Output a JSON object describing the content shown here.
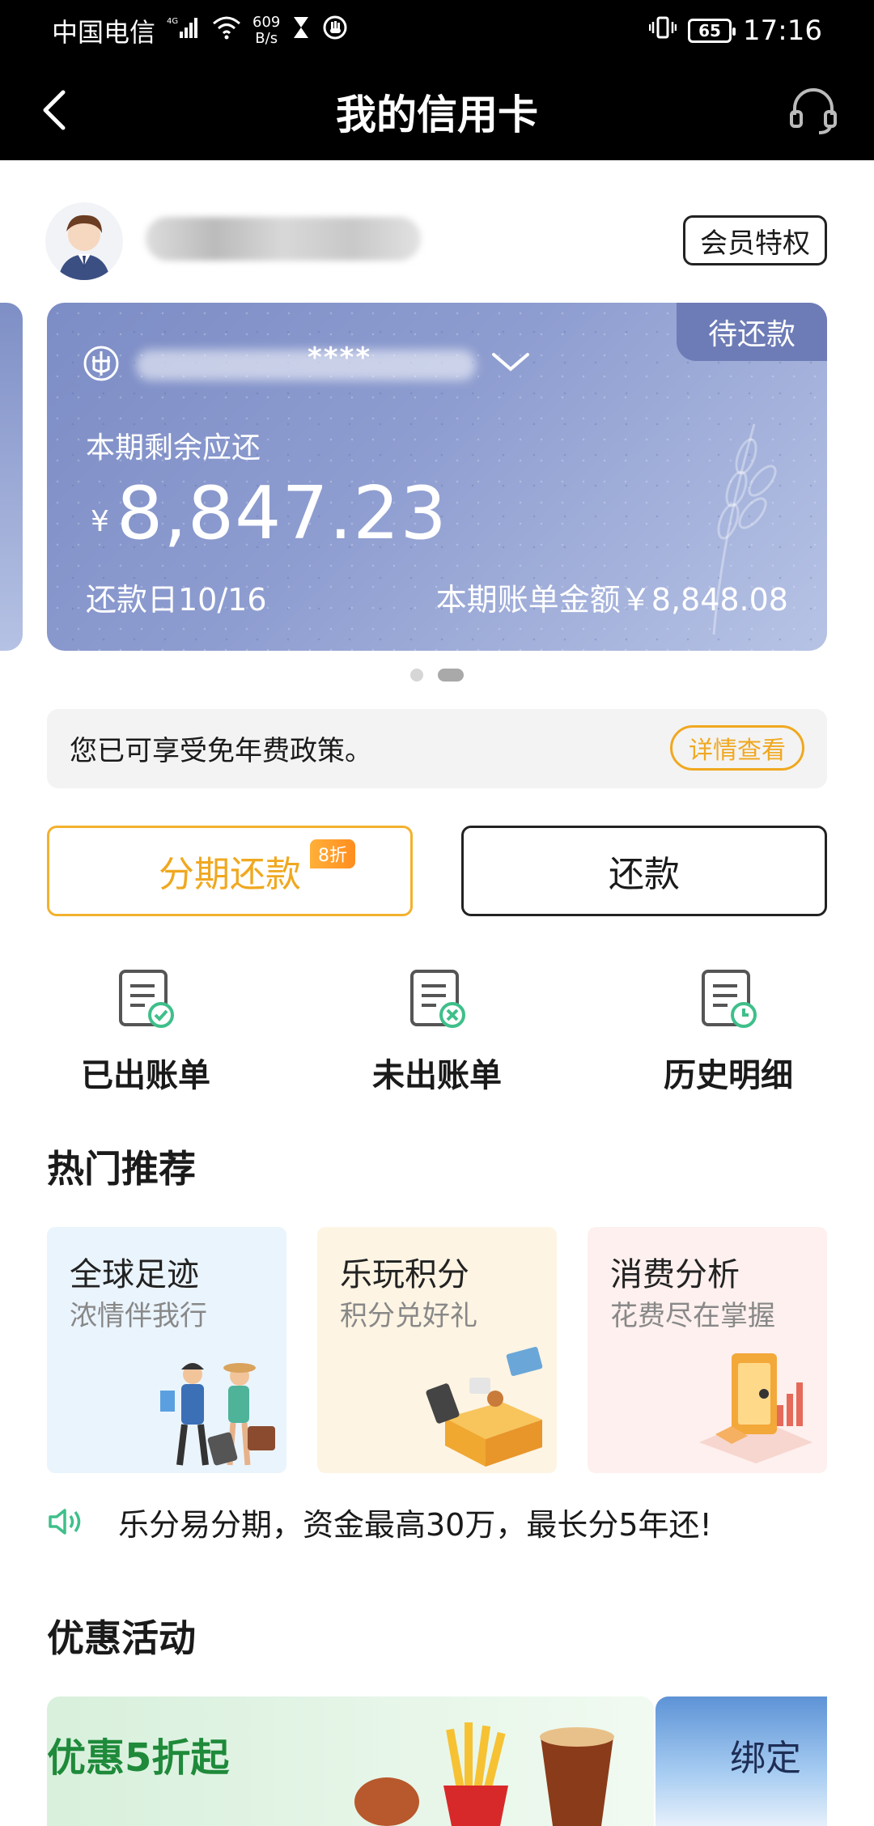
{
  "status_bar": {
    "carrier": "中国电信",
    "network": "4G",
    "net_speed_value": "609",
    "net_speed_unit": "B/s",
    "battery": "65",
    "time": "17:16"
  },
  "header": {
    "title": "我的信用卡"
  },
  "user": {
    "vip_label": "会员特权"
  },
  "card": {
    "status_tag": "待还款",
    "masked_number": "****",
    "remaining_label": "本期剩余应还",
    "currency_symbol": "¥",
    "remaining_amount": "8,847.23",
    "due_date": "还款日10/16",
    "bill_amount": "本期账单金额￥8,848.08"
  },
  "notice": {
    "text": "您已可享受免年费政策。",
    "button": "详情查看"
  },
  "actions": {
    "installment_label": "分期还款",
    "installment_badge": "8折",
    "pay_label": "还款"
  },
  "quick_actions": [
    {
      "label": "已出账单",
      "icon": "bill-issued-icon"
    },
    {
      "label": "未出账单",
      "icon": "bill-unissued-icon"
    },
    {
      "label": "历史明细",
      "icon": "history-icon"
    }
  ],
  "hot_section": {
    "title": "热门推荐"
  },
  "promos": [
    {
      "title": "全球足迹",
      "subtitle": "浓情伴我行",
      "bg": "#eaf4fc"
    },
    {
      "title": "乐玩积分",
      "subtitle": "积分兑好礼",
      "bg": "#fdf4e3"
    },
    {
      "title": "消费分析",
      "subtitle": "花费尽在掌握",
      "bg": "#fdf0ee"
    }
  ],
  "ticker": {
    "text": "乐分易分期，资金最高30万，最长分5年还!"
  },
  "offers_section": {
    "title": "优惠活动"
  },
  "banners": [
    {
      "title": "优惠5折起"
    },
    {
      "title": "绑定"
    }
  ],
  "colors": {
    "accent_orange": "#f0a820",
    "card_blue": "#8e9dd0",
    "speaker_green": "#3fbf8a"
  }
}
